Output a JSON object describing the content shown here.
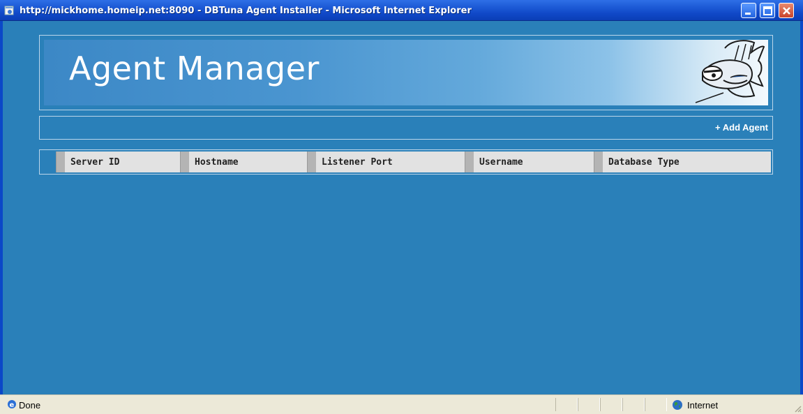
{
  "window": {
    "title": "http://mickhome.homeip.net:8090 - DBTuna Agent Installer - Microsoft Internet Explorer"
  },
  "header": {
    "title": "Agent Manager"
  },
  "toolbar": {
    "add_agent_label": "+ Add Agent"
  },
  "table": {
    "columns": [
      "Server ID",
      "Hostname",
      "Listener Port",
      "Username",
      "Database Type"
    ],
    "rows": []
  },
  "statusbar": {
    "status": "Done",
    "zone": "Internet"
  },
  "colors": {
    "page_background": "#2a80b9",
    "titlebar": "#0f47c6",
    "statusbar": "#ece9d8"
  },
  "icons": [
    "ie-page-icon",
    "minimize-icon",
    "maximize-icon",
    "close-icon",
    "fish-mascot-logo",
    "ie-status-icon",
    "internet-globe-icon",
    "resize-grip-icon"
  ]
}
